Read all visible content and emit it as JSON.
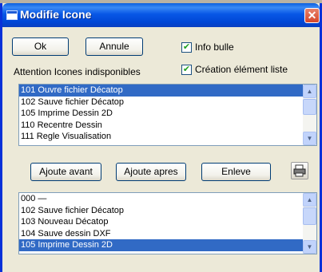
{
  "window": {
    "title": "Modifie Icone"
  },
  "toolbar": {
    "ok_label": "Ok",
    "cancel_label": "Annule"
  },
  "options": {
    "info_bulle": {
      "label": "Info bulle",
      "checked": true
    },
    "creation_liste": {
      "label": "Création élément liste",
      "checked": true
    }
  },
  "warning": "Attention Icones indisponibles",
  "available_list": {
    "items": [
      {
        "text": "101 Ouvre fichier Décatop",
        "selected": true
      },
      {
        "text": "102 Sauve fichier Décatop",
        "selected": false
      },
      {
        "text": "105 Imprime Dessin 2D",
        "selected": false
      },
      {
        "text": "110 Recentre Dessin",
        "selected": false
      },
      {
        "text": "111 Regle Visualisation",
        "selected": false
      }
    ]
  },
  "actions": {
    "add_before_label": "Ajoute avant",
    "add_after_label": "Ajoute apres",
    "remove_label": "Enleve"
  },
  "toolbar_list": {
    "items": [
      {
        "text": "000 —",
        "selected": false
      },
      {
        "text": "102 Sauve fichier Décatop",
        "selected": false
      },
      {
        "text": "103 Nouveau Décatop",
        "selected": false
      },
      {
        "text": "104 Sauve dessin DXF",
        "selected": false
      },
      {
        "text": "105 Imprime Dessin 2D",
        "selected": true
      }
    ]
  },
  "icons": {
    "title": "window-icon",
    "close": "close-icon",
    "print": "printer-icon",
    "scroll_up": "arrow-up-icon",
    "scroll_down": "arrow-down-icon"
  },
  "colors": {
    "titlebar": "#0054e3",
    "selection": "#316ac5",
    "dialog_bg": "#ece9d8",
    "check_mark": "#21a121"
  }
}
